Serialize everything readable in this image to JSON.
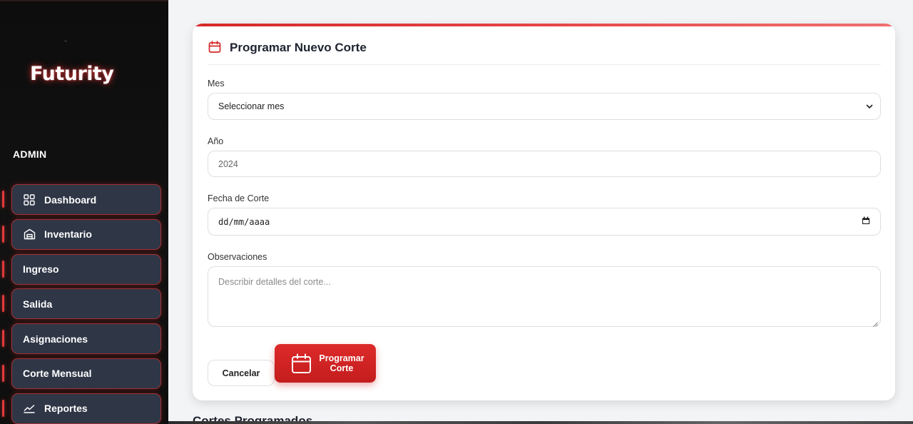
{
  "app": {
    "logo": "Futurity"
  },
  "sidebar": {
    "role_label": "ADMIN",
    "items": [
      {
        "label": "Dashboard",
        "icon": "grid-icon"
      },
      {
        "label": "Inventario",
        "icon": "warehouse-icon"
      },
      {
        "label": "Ingreso",
        "icon": ""
      },
      {
        "label": "Salida",
        "icon": ""
      },
      {
        "label": "Asignaciones",
        "icon": ""
      },
      {
        "label": "Corte Mensual",
        "icon": ""
      },
      {
        "label": "Reportes",
        "icon": "chart-line-icon"
      }
    ]
  },
  "form": {
    "title": "Programar Nuevo Corte",
    "mes": {
      "label": "Mes",
      "value": "Seleccionar mes"
    },
    "anio": {
      "label": "Año",
      "value": "2024"
    },
    "fecha": {
      "label": "Fecha de Corte",
      "value": "dd/mm/aaaa"
    },
    "observaciones": {
      "label": "Observaciones",
      "placeholder": "Describir detalles del corte..."
    },
    "cancel_label": "Cancelar",
    "submit_label": "Programar Corte"
  },
  "next_section": {
    "title": "Cortes Programados"
  },
  "colors": {
    "accent": "#d62828",
    "sidebar_bg": "#0f0f0f",
    "nav_bg": "#2f3646",
    "page_bg": "#f3f4f6"
  }
}
